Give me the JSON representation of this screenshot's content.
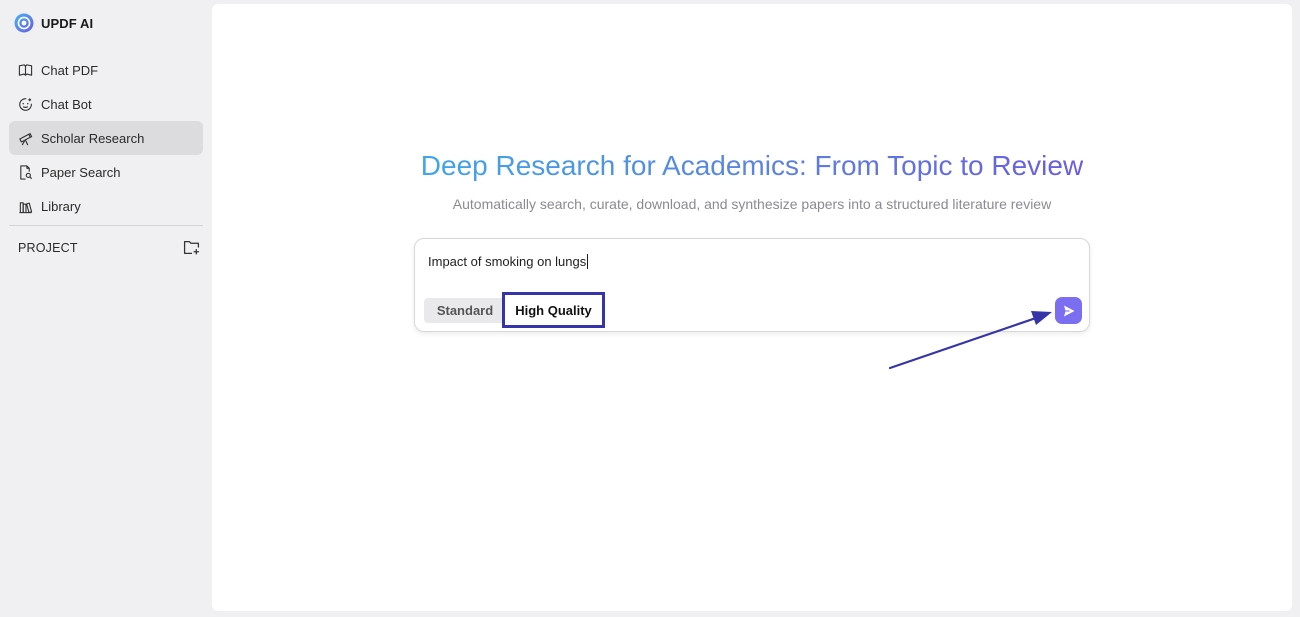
{
  "brand": {
    "name": "UPDF AI",
    "logo_icon": "updf-ai-logo-icon"
  },
  "sidebar": {
    "items": [
      {
        "label": "Chat PDF",
        "icon": "book-open-icon",
        "active": false
      },
      {
        "label": "Chat Bot",
        "icon": "bot-face-icon",
        "active": false
      },
      {
        "label": "Scholar Research",
        "icon": "telescope-icon",
        "active": true
      },
      {
        "label": "Paper Search",
        "icon": "document-search-icon",
        "active": false
      },
      {
        "label": "Library",
        "icon": "books-icon",
        "active": false
      }
    ],
    "project_label": "PROJECT",
    "project_action_icon": "folder-add-icon"
  },
  "main": {
    "title": "Deep Research for Academics: From Topic to Review",
    "subtitle": "Automatically search, curate, download, and synthesize papers into a structured literature review",
    "query": {
      "value": "Impact of smoking on lungs"
    },
    "modes": [
      {
        "label": "Standard",
        "selected": false
      },
      {
        "label": "High Quality",
        "selected": true
      }
    ],
    "send_icon": "send-icon"
  },
  "colors": {
    "accent": "#7b6ef0",
    "title_gradient_start": "#3fa6ea",
    "title_gradient_end": "#6a5ce0",
    "highlight_box": "#3535a8",
    "annotation_arrow": "#3535a8"
  }
}
